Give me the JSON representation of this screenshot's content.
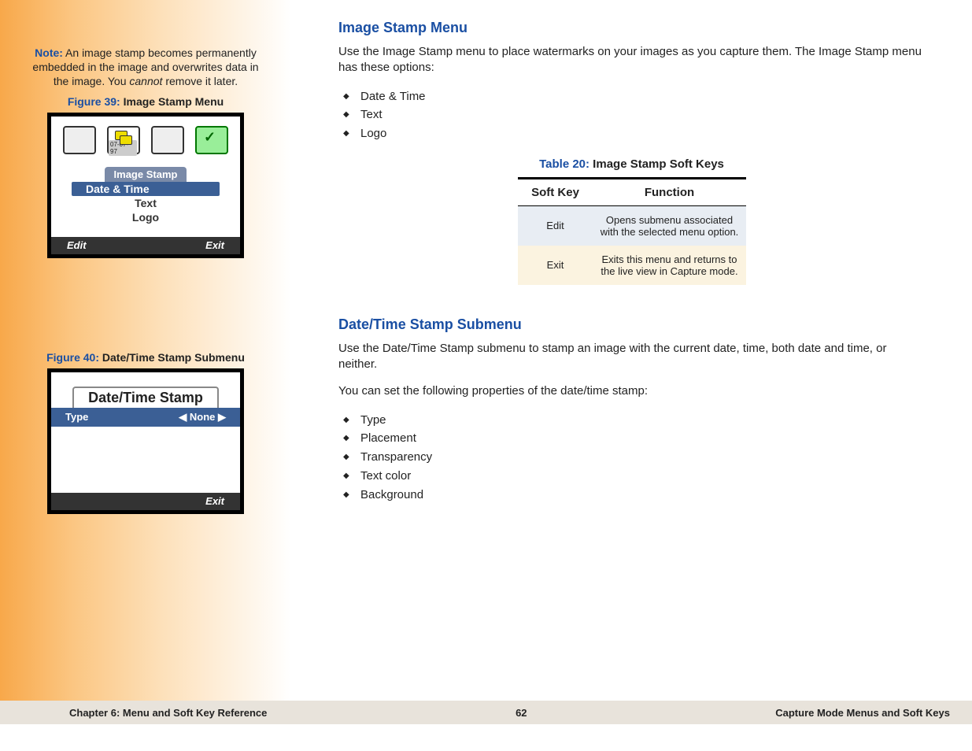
{
  "sidebar": {
    "note": {
      "label": "Note:",
      "text_a": " An image stamp becomes permanently embedded in the image and overwrites data in the image. You ",
      "cannot": "cannot",
      "text_b": "  remove it later."
    },
    "fig39": {
      "no": "Figure 39:",
      "title": " Image Stamp Menu"
    },
    "scr1": {
      "date_badge": "07-07-97",
      "menu_title": "Image Stamp",
      "items": [
        "Date & Time",
        "Text",
        "Logo"
      ],
      "left": "Edit",
      "right": "Exit"
    },
    "fig40": {
      "no": "Figure 40:",
      "title": " Date/Time Stamp Submenu"
    },
    "scr2": {
      "title": "Date/Time Stamp",
      "row_label": "Type",
      "row_value": "None",
      "right": "Exit"
    }
  },
  "main": {
    "h1": "Image Stamp Menu",
    "p1": "Use the Image Stamp menu to place watermarks on your images as you capture them. The Image Stamp menu has these options:",
    "list1": [
      "Date & Time",
      "Text",
      "Logo"
    ],
    "table": {
      "caption_no": "Table 20:",
      "caption": " Image Stamp Soft Keys",
      "head": [
        "Soft Key",
        "Function"
      ],
      "rows": [
        {
          "k": "Edit",
          "v": "Opens submenu associated with the selected menu option."
        },
        {
          "k": "Exit",
          "v": "Exits this menu and returns to the live view in Capture mode."
        }
      ]
    },
    "h2": "Date/Time Stamp Submenu",
    "p2": "Use the Date/Time Stamp submenu to stamp an image with the current date, time, both date and time, or neither.",
    "p3": "You can set the following properties of the date/time stamp:",
    "list2": [
      "Type",
      "Placement",
      "Transparency",
      "Text color",
      "Background"
    ]
  },
  "footer": {
    "left": "Chapter 6: Menu and Soft Key Reference",
    "center": "62",
    "right": "Capture Mode Menus and Soft Keys"
  }
}
